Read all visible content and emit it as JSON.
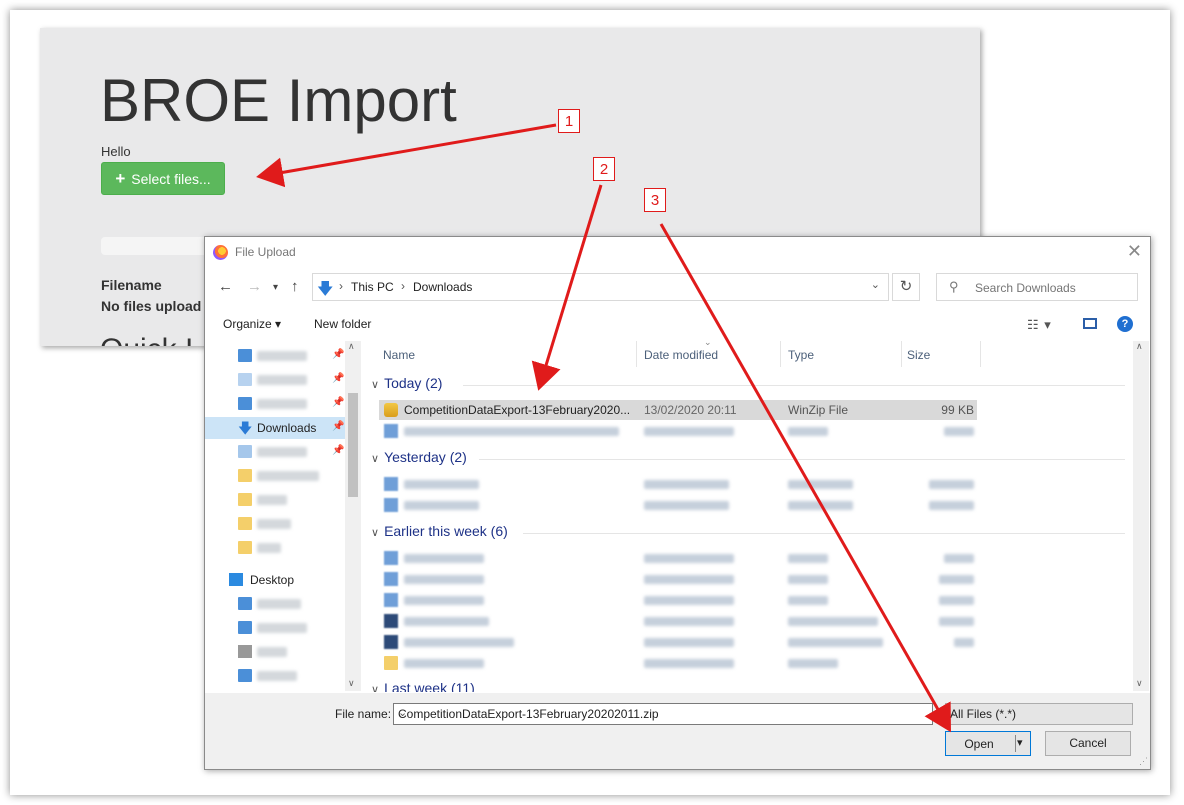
{
  "web": {
    "title": "BROE Import",
    "hello": "Hello",
    "select_button": "Select files...",
    "filename_header": "Filename",
    "no_files": "No files upload",
    "section_heading_partial": "Quick I"
  },
  "dialog": {
    "title": "File Upload",
    "breadcrumb": [
      "This PC",
      "Downloads"
    ],
    "search_placeholder": "Search Downloads",
    "toolbar": {
      "organize": "Organize",
      "new_folder": "New folder"
    },
    "nav": {
      "downloads": "Downloads",
      "desktop": "Desktop"
    },
    "columns": {
      "name": "Name",
      "date": "Date modified",
      "type": "Type",
      "size": "Size"
    },
    "groups": {
      "today": "Today (2)",
      "yesterday": "Yesterday (2)",
      "earlier": "Earlier this week (6)",
      "last_week": "Last week (11)"
    },
    "selected_file": {
      "name": "CompetitionDataExport-13February2020...",
      "date": "13/02/2020 20:11",
      "type": "WinZip File",
      "size": "99 KB"
    },
    "file_name_label": "File name:",
    "file_name_value": "CompetitionDataExport-13February20202011.zip",
    "filter": "All Files (*.*)",
    "open": "Open",
    "cancel": "Cancel"
  },
  "callouts": [
    "1",
    "2",
    "3"
  ],
  "colors": {
    "accent_red": "#e01b1b",
    "button_green": "#5cb85c",
    "group_blue": "#1e3287"
  }
}
